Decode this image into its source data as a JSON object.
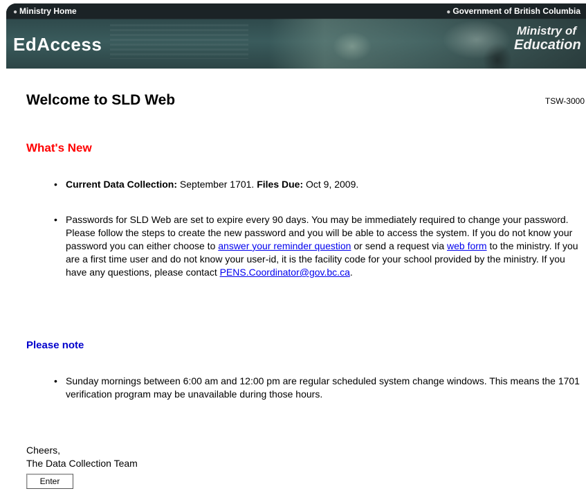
{
  "banner": {
    "home_link": "Ministry Home",
    "gov_link": "Government of British Columbia",
    "app_title": "EdAccess",
    "logo_line1": "Ministry of",
    "logo_line2": "Education"
  },
  "page": {
    "title": "Welcome to SLD Web",
    "screen_id": "TSW-3000"
  },
  "whats_new": {
    "heading": "What's New",
    "item1": {
      "label1": "Current Data Collection:",
      "text1": " September 1701. ",
      "label2": "Files Due:",
      "text2": " Oct 9, 2009."
    },
    "item2": {
      "text1": "Passwords for SLD Web are set to expire every 90 days. You may be immediately required to change your password. Please follow the steps to create the new password and you will be able to access the system. If you do not know your password you can either choose to ",
      "link1": "answer your reminder question",
      "text2": " or send a request via ",
      "link2": "web form",
      "text3": " to the ministry. If you are a first time user and do not know your user-id, it is the facility code for your school provided by the ministry. If you have any questions, please contact ",
      "email": "PENS.Coordinator@gov.bc.ca",
      "text4": "."
    }
  },
  "please_note": {
    "heading": "Please note",
    "item1": "Sunday mornings between 6:00 am and 12:00 pm are regular scheduled system change windows. This means the 1701 verification program may be unavailable during those hours."
  },
  "signoff": {
    "line1": "Cheers,",
    "line2": "The Data Collection Team"
  },
  "enter_button": "Enter"
}
